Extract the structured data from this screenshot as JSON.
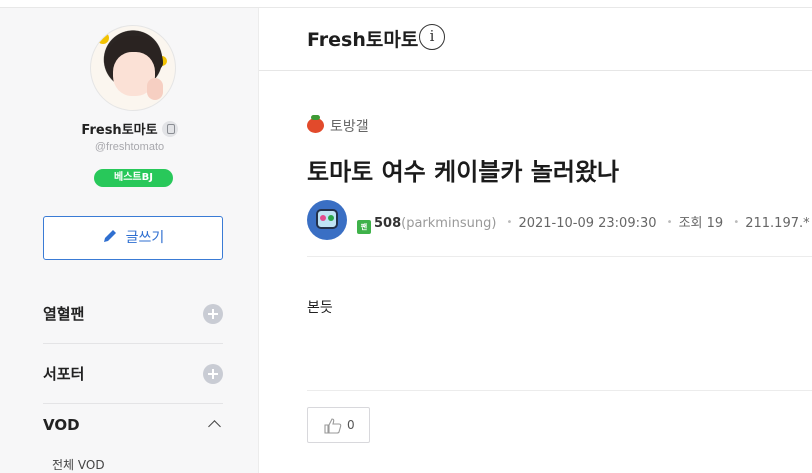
{
  "sidebar": {
    "nickname": "Fresh토마토",
    "handle": "@freshtomato",
    "badge": "베스트BJ",
    "write_label": "글쓰기",
    "menu": [
      {
        "label": "열혈팬"
      },
      {
        "label": "서포터"
      }
    ],
    "vod_label": "VOD",
    "vod_sub": "전체 VOD"
  },
  "header": {
    "title": "Fresh토마토",
    "info_glyph": "i"
  },
  "post": {
    "category": "토방갤",
    "title": "토마토 여수 케이블카 놀러왔나",
    "author_fan_level": "팬",
    "author_num": "508",
    "author_id": "(parkminsung)",
    "datetime": "2021-10-09 23:09:30",
    "views_label": "조회 19",
    "ip": "211.197.*",
    "body": "본듯",
    "likes": "0"
  },
  "colors": {
    "accent": "#3a7bd5",
    "badge_green": "#28c85a",
    "tomato": "#e24a2b"
  }
}
